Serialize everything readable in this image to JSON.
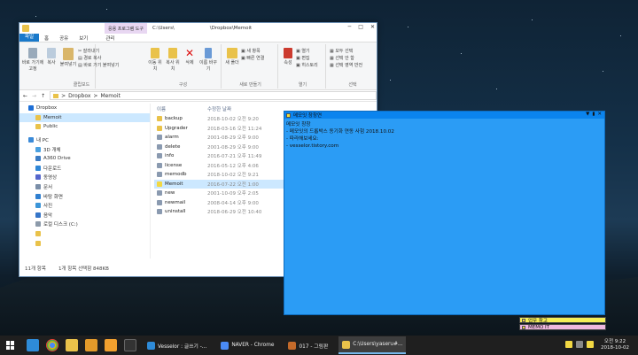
{
  "explorer": {
    "context_tab": "응용 프로그램 도구",
    "title_left": "C:\\Users\\",
    "title_right": "\\Dropbox\\Memoit",
    "menu": {
      "file": "파일",
      "home": "홈",
      "share": "공유",
      "view": "보기",
      "manage": "관리"
    },
    "ribbon": {
      "pin": "바로 가기에 고정",
      "copy": "복사",
      "paste": "붙여넣기",
      "cut": "잘라내기",
      "copy_path": "경로 복사",
      "paste_shortcut": "바로 가기 붙여넣기",
      "move_to": "이동 위치",
      "copy_to": "복사 위치",
      "delete": "삭제",
      "rename": "이름 바꾸기",
      "new_folder": "새 폴더",
      "new_item": "새 항목",
      "easy_access": "빠른 연결",
      "properties": "속성",
      "open": "열기",
      "edit": "편집",
      "history": "히스토리",
      "select_all": "모두 선택",
      "select_none": "선택 안 함",
      "invert_selection": "선택 영역 반전",
      "groups": {
        "clipboard": "클립보드",
        "organize": "구성",
        "new": "새로 만들기",
        "open": "열기",
        "select": "선택"
      }
    },
    "breadcrumb": {
      "sep": ">",
      "a": "Dropbox",
      "b": "Memoit"
    },
    "nav": [
      {
        "label": "Dropbox",
        "color": "#1e6fd6",
        "lvl": "l1",
        "sel": false
      },
      {
        "label": "Memoit",
        "color": "#e9c24a",
        "lvl": "l2",
        "sel": true
      },
      {
        "label": "Public",
        "color": "#e9c24a",
        "lvl": "l2",
        "sel": false
      },
      {
        "label": "내 PC",
        "color": "#3a8ad8",
        "lvl": "l1",
        "sel": false
      },
      {
        "label": "3D 개체",
        "color": "#4aa0e0",
        "lvl": "l2",
        "sel": false
      },
      {
        "label": "A360 Drive",
        "color": "#3a7bc4",
        "lvl": "l2",
        "sel": false
      },
      {
        "label": "다운로드",
        "color": "#2f86d6",
        "lvl": "l2",
        "sel": false
      },
      {
        "label": "동영상",
        "color": "#5566cc",
        "lvl": "l2",
        "sel": false
      },
      {
        "label": "문서",
        "color": "#7a8ea8",
        "lvl": "l2",
        "sel": false
      },
      {
        "label": "바탕 화면",
        "color": "#2f7fd0",
        "lvl": "l2",
        "sel": false
      },
      {
        "label": "사진",
        "color": "#3c95d8",
        "lvl": "l2",
        "sel": false
      },
      {
        "label": "음악",
        "color": "#3575c8",
        "lvl": "l2",
        "sel": false
      },
      {
        "label": "로컬 디스크 (C:)",
        "color": "#8c9aaa",
        "lvl": "l2",
        "sel": false
      },
      {
        "label": "",
        "color": "#e9c24a",
        "lvl": "l2",
        "sel": false
      },
      {
        "label": "",
        "color": "#e9c24a",
        "lvl": "l2",
        "sel": false
      }
    ],
    "list_header": {
      "name": "이름",
      "date": "수정한 날짜"
    },
    "files": [
      {
        "name": "backup",
        "date": "2018-10-02 오전 9:20",
        "color": "#e9c24a",
        "sel": false
      },
      {
        "name": "Upgrader",
        "date": "2018-03-16 오전 11:24",
        "color": "#e9c24a",
        "sel": false
      },
      {
        "name": "alarm",
        "date": "2001-08-29 오후 9:00",
        "color": "#8a9ab0",
        "sel": false
      },
      {
        "name": "delete",
        "date": "2001-08-29 오후 9:00",
        "color": "#8a9ab0",
        "sel": false
      },
      {
        "name": "info",
        "date": "2016-07-21 오후 11:49",
        "color": "#8a9ab0",
        "sel": false
      },
      {
        "name": "license",
        "date": "2016-05-12 오후 4:06",
        "color": "#8a9ab0",
        "sel": false
      },
      {
        "name": "memodb",
        "date": "2018-10-02 오전 9:21",
        "color": "#8a9ab0",
        "sel": false
      },
      {
        "name": "Memoit",
        "date": "2016-07-22 오전 1:00",
        "color": "#f2d843",
        "sel": true
      },
      {
        "name": "new",
        "date": "2001-10-09 오후 2:05",
        "color": "#8a9ab0",
        "sel": false
      },
      {
        "name": "newmail",
        "date": "2008-04-14 오후 9:00",
        "color": "#8a9ab0",
        "sel": false
      },
      {
        "name": "uninstall",
        "date": "2018-06-29 오전 10:40",
        "color": "#8a9ab0",
        "sel": false
      }
    ],
    "status": {
      "count": "11개 항목",
      "selected": "1개 항목 선택함 848KB"
    }
  },
  "memo": {
    "title": "메모잇 창창연",
    "text": "메모잇 창창\n- 메모잇의 드롭박스 동기화 연동 사험 2018.10.02\n- 따라해보세요:\n- vesselor.tistory.com"
  },
  "stickies": [
    {
      "label": "업무 참고",
      "color": "#f4ee58"
    },
    {
      "label": "MEMO IT",
      "color": "#f0b8e0"
    }
  ],
  "taskbar": {
    "tasks": [
      {
        "label": "Vesselor : 글쓰기 -...",
        "active": false
      },
      {
        "label": "NAVER - Chrome",
        "active": false
      },
      {
        "label": "017 - 그림판",
        "active": false
      },
      {
        "label": "C:\\Users\\yaseru#...",
        "active": true
      }
    ],
    "time": "오전 9:22",
    "date": "2018-10-02"
  }
}
